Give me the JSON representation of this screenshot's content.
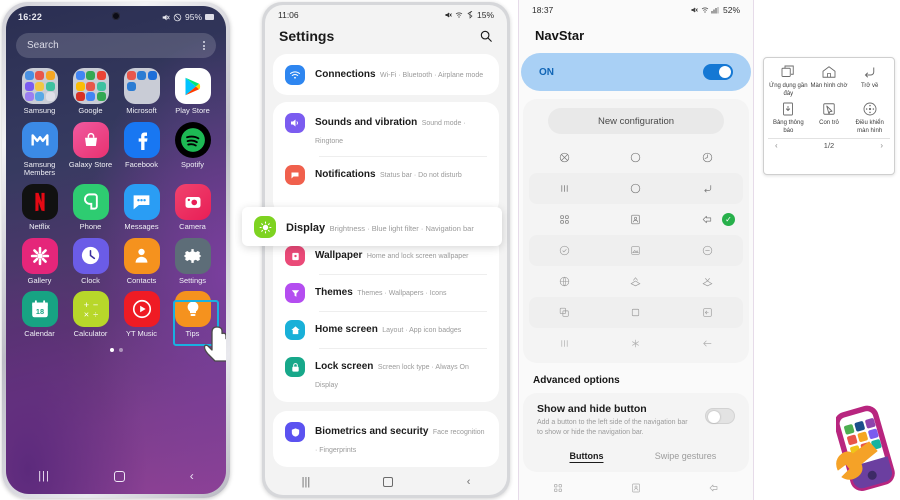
{
  "phone1": {
    "status": {
      "time": "16:22",
      "battery": "95%",
      "icons": [
        "mute-icon",
        "dnd-icon"
      ]
    },
    "search": {
      "placeholder": "Search",
      "menu_icon": "more-options-icon"
    },
    "apps": [
      {
        "label": "Samsung",
        "icon": "samsung-folder-icon",
        "type": "folder"
      },
      {
        "label": "Google",
        "icon": "google-folder-icon",
        "type": "folder"
      },
      {
        "label": "Microsoft",
        "icon": "microsoft-folder-icon",
        "type": "folder"
      },
      {
        "label": "Play Store",
        "icon": "play-store-icon",
        "type": "app"
      },
      {
        "label": "Samsung Members",
        "icon": "samsung-members-icon",
        "type": "app"
      },
      {
        "label": "Galaxy Store",
        "icon": "galaxy-store-icon",
        "type": "app"
      },
      {
        "label": "Facebook",
        "icon": "facebook-icon",
        "type": "app"
      },
      {
        "label": "Spotify",
        "icon": "spotify-icon",
        "type": "app"
      },
      {
        "label": "Netflix",
        "icon": "netflix-icon",
        "type": "app"
      },
      {
        "label": "Phone",
        "icon": "phone-icon",
        "type": "app"
      },
      {
        "label": "Messages",
        "icon": "messages-icon",
        "type": "app"
      },
      {
        "label": "Camera",
        "icon": "camera-icon",
        "type": "app"
      },
      {
        "label": "Gallery",
        "icon": "gallery-icon",
        "type": "app"
      },
      {
        "label": "Clock",
        "icon": "clock-icon",
        "type": "app"
      },
      {
        "label": "Contacts",
        "icon": "contacts-icon",
        "type": "app"
      },
      {
        "label": "Settings",
        "icon": "settings-gear-icon",
        "type": "app"
      },
      {
        "label": "Calendar",
        "icon": "calendar-icon",
        "badge": "18",
        "type": "app"
      },
      {
        "label": "Calculator",
        "icon": "calculator-icon",
        "type": "app"
      },
      {
        "label": "YT Music",
        "icon": "youtube-music-icon",
        "type": "app"
      },
      {
        "label": "Tips",
        "icon": "tips-bulb-icon",
        "type": "app"
      }
    ],
    "highlight_color": "#19b0e0",
    "page_indicator": {
      "total": 2,
      "current": 1
    },
    "navbar": [
      "recents-icon",
      "home-icon",
      "back-icon"
    ]
  },
  "phone2": {
    "status": {
      "time": "11:06",
      "battery": "15%"
    },
    "header": {
      "title": "Settings",
      "search_icon": "search-icon"
    },
    "groups": [
      {
        "items": [
          {
            "title": "Connections",
            "subtitle": "Wi-Fi · Bluetooth · Airplane mode",
            "icon": "wifi-icon",
            "color": "#2e86f0"
          }
        ]
      },
      {
        "items": [
          {
            "title": "Sounds and vibration",
            "subtitle": "Sound mode · Ringtone",
            "icon": "volume-icon",
            "color": "#7b5cf0"
          },
          {
            "title": "Notifications",
            "subtitle": "Status bar · Do not disturb",
            "icon": "notification-icon",
            "color": "#f0604d"
          }
        ]
      },
      {
        "items": [
          {
            "title": "Wallpaper",
            "subtitle": "Home and lock screen wallpaper",
            "icon": "wallpaper-icon",
            "color": "#ea4a78"
          },
          {
            "title": "Themes",
            "subtitle": "Themes · Wallpapers · Icons",
            "icon": "themes-icon",
            "color": "#b44df0"
          },
          {
            "title": "Home screen",
            "subtitle": "Layout · App icon badges",
            "icon": "home-icon",
            "color": "#19b0d8"
          },
          {
            "title": "Lock screen",
            "subtitle": "Screen lock type · Always On Display",
            "icon": "lock-icon",
            "color": "#17a88a"
          }
        ]
      },
      {
        "items": [
          {
            "title": "Biometrics and security",
            "subtitle": "Face recognition · Fingerprints",
            "icon": "shield-icon",
            "color": "#5b52f0"
          }
        ]
      }
    ],
    "highlighted": {
      "title": "Display",
      "subtitle": "Brightness · Blue light filter · Navigation bar",
      "icon": "display-icon",
      "color": "#7ed321"
    },
    "navbar": [
      "recents-icon",
      "home-icon",
      "back-icon"
    ]
  },
  "phone3": {
    "status": {
      "time": "18:37",
      "battery": "52%"
    },
    "title": "NavStar",
    "master_toggle": {
      "label": "ON",
      "state": "on",
      "color": "#1578d4"
    },
    "new_configuration": "New configuration",
    "nav_rows": [
      {
        "icons": [
          "circle-x-icon",
          "circle-icon",
          "circle-clock-icon"
        ],
        "selected": false
      },
      {
        "icons": [
          "recents-bars-icon",
          "circle-icon",
          "return-arrow-icon"
        ],
        "selected": false
      },
      {
        "icons": [
          "grid-dots-icon",
          "person-frame-icon",
          "back-arrow-icon"
        ],
        "selected": true
      },
      {
        "icons": [
          "check-circle-icon",
          "image-frame-icon",
          "minus-circle-icon"
        ],
        "selected": false
      },
      {
        "icons": [
          "globe-icon",
          "stack-up-icon",
          "stack-down-icon"
        ],
        "selected": false
      },
      {
        "icons": [
          "copy-icon",
          "square-icon",
          "panel-arrow-icon"
        ],
        "selected": false
      },
      {
        "icons": [
          "recents-bars-icon",
          "asterisk-icon",
          "arrow-left-icon"
        ],
        "selected": false
      }
    ],
    "advanced_header": "Advanced options",
    "show_hide": {
      "title": "Show and hide button",
      "subtitle": "Add a button to the left side of the navigation bar to show or hide the navigation bar.",
      "state": "off"
    },
    "tabs": [
      {
        "label": "Buttons",
        "active": true
      },
      {
        "label": "Swipe gestures",
        "active": false
      }
    ],
    "bottomnav": [
      "grid-dots-icon",
      "person-frame-icon",
      "back-arrow-icon"
    ]
  },
  "panel4": {
    "items": [
      {
        "label": "Ứng dụng gần đây",
        "icon": "recent-apps-icon"
      },
      {
        "label": "Màn hình chờ",
        "icon": "home-outline-icon"
      },
      {
        "label": "Trở về",
        "icon": "back-curve-icon"
      },
      {
        "label": "Bảng thông báo",
        "icon": "notification-panel-icon"
      },
      {
        "label": "Con trỏ",
        "icon": "pointer-icon"
      },
      {
        "label": "Điều khiển màn hình",
        "icon": "screen-control-icon"
      }
    ],
    "pager": {
      "prev_icon": "chevron-left-icon",
      "label": "1/2",
      "next_icon": "chevron-right-icon"
    }
  },
  "logo": {
    "name": "phone-repair-logo",
    "colors": [
      "#b8257f",
      "#5c3b99",
      "#f5a227"
    ]
  }
}
